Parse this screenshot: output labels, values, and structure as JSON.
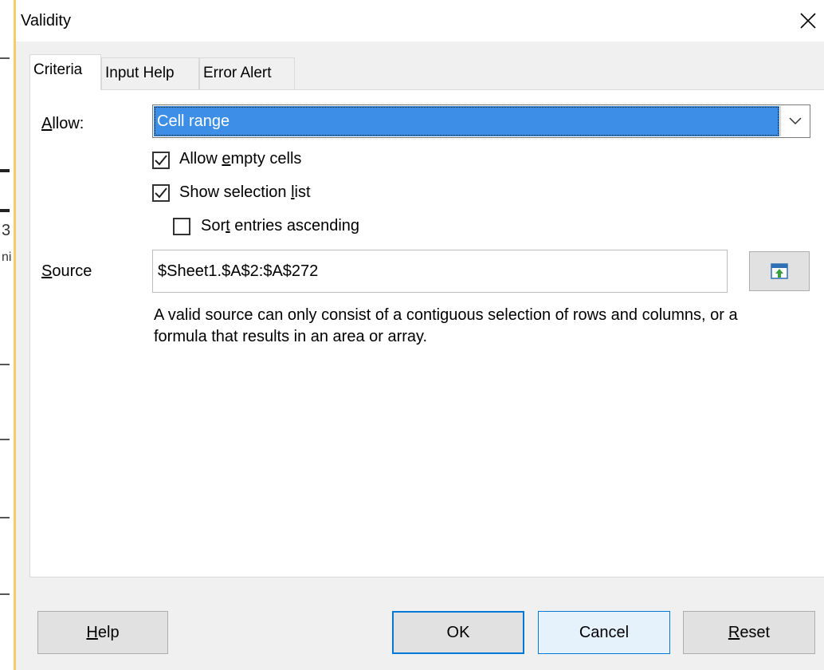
{
  "window": {
    "title": "Validity",
    "close_icon": "close-icon"
  },
  "background_window": {
    "glyph_1": "3",
    "glyph_2": "ni"
  },
  "tabs": [
    {
      "label": "Criteria",
      "active": true
    },
    {
      "label": "Input Help",
      "active": false
    },
    {
      "label": "Error Alert",
      "active": false
    }
  ],
  "criteria": {
    "allow_label": "Allow:",
    "allow_value": "Cell range",
    "allow_empty_cells": {
      "label": "Allow empty cells",
      "checked": true
    },
    "show_selection_list": {
      "label": "Show selection list",
      "checked": true
    },
    "sort_entries_ascending": {
      "label": "Sort entries ascending",
      "checked": false
    },
    "source_label": "Source",
    "source_value": "$Sheet1.$A$2:$A$272",
    "shrink_icon": "shrink-icon",
    "hint": "A valid source can only consist of a contiguous selection of rows and columns, or a formula that results in an area or array."
  },
  "buttons": {
    "help": "Help",
    "ok": "OK",
    "cancel": "Cancel",
    "reset": "Reset"
  },
  "colors": {
    "selection": "#3d8ee6",
    "focus_border": "#0078d7",
    "window_edge": "#f4cd66"
  }
}
